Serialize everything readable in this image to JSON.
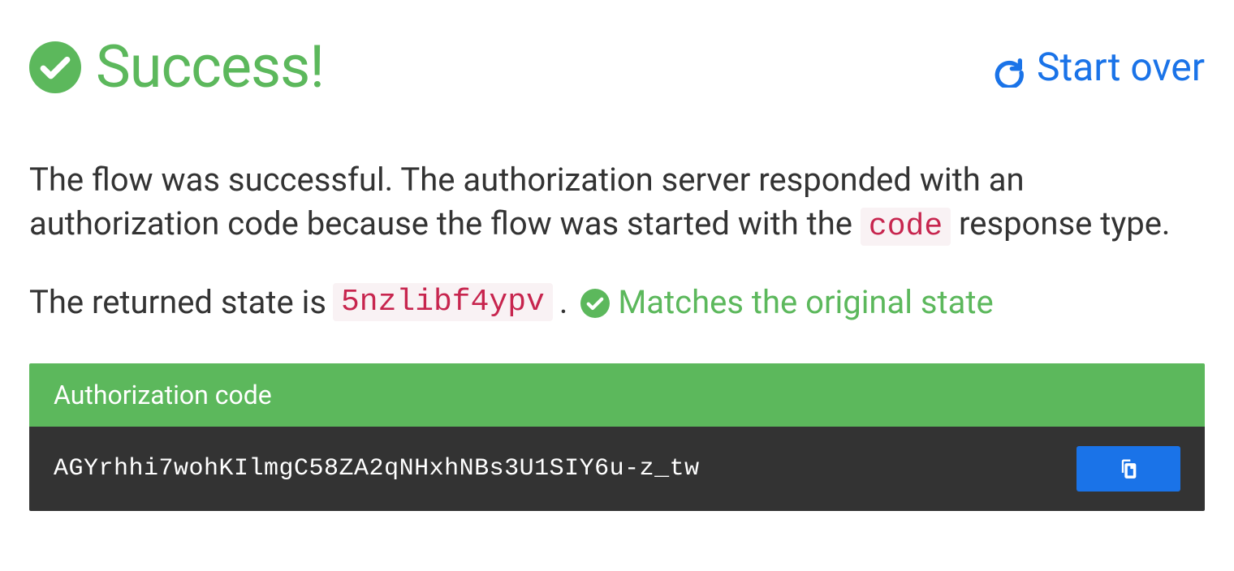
{
  "header": {
    "success_title": "Success!",
    "start_over_label": "Start over"
  },
  "description": {
    "text_before_code": "The flow was successful. The authorization server responded with an authorization code because the flow was started with the ",
    "code_label": "code",
    "text_after_code": " response type."
  },
  "state": {
    "label_prefix": "The returned state is ",
    "state_value": "5nzlibf4ypv",
    "period": ".",
    "match_message": "Matches the original state"
  },
  "auth_code": {
    "header_label": "Authorization code",
    "code_value": "AGYrhhi7wohKIlmgC58ZA2qNHxhNBs3U1SIY6u-z_tw"
  },
  "colors": {
    "success_green": "#5cb85c",
    "link_blue": "#1a73e8",
    "code_red": "#c7254e",
    "code_bg": "#f9f2f4",
    "dark_bg": "#333333"
  }
}
